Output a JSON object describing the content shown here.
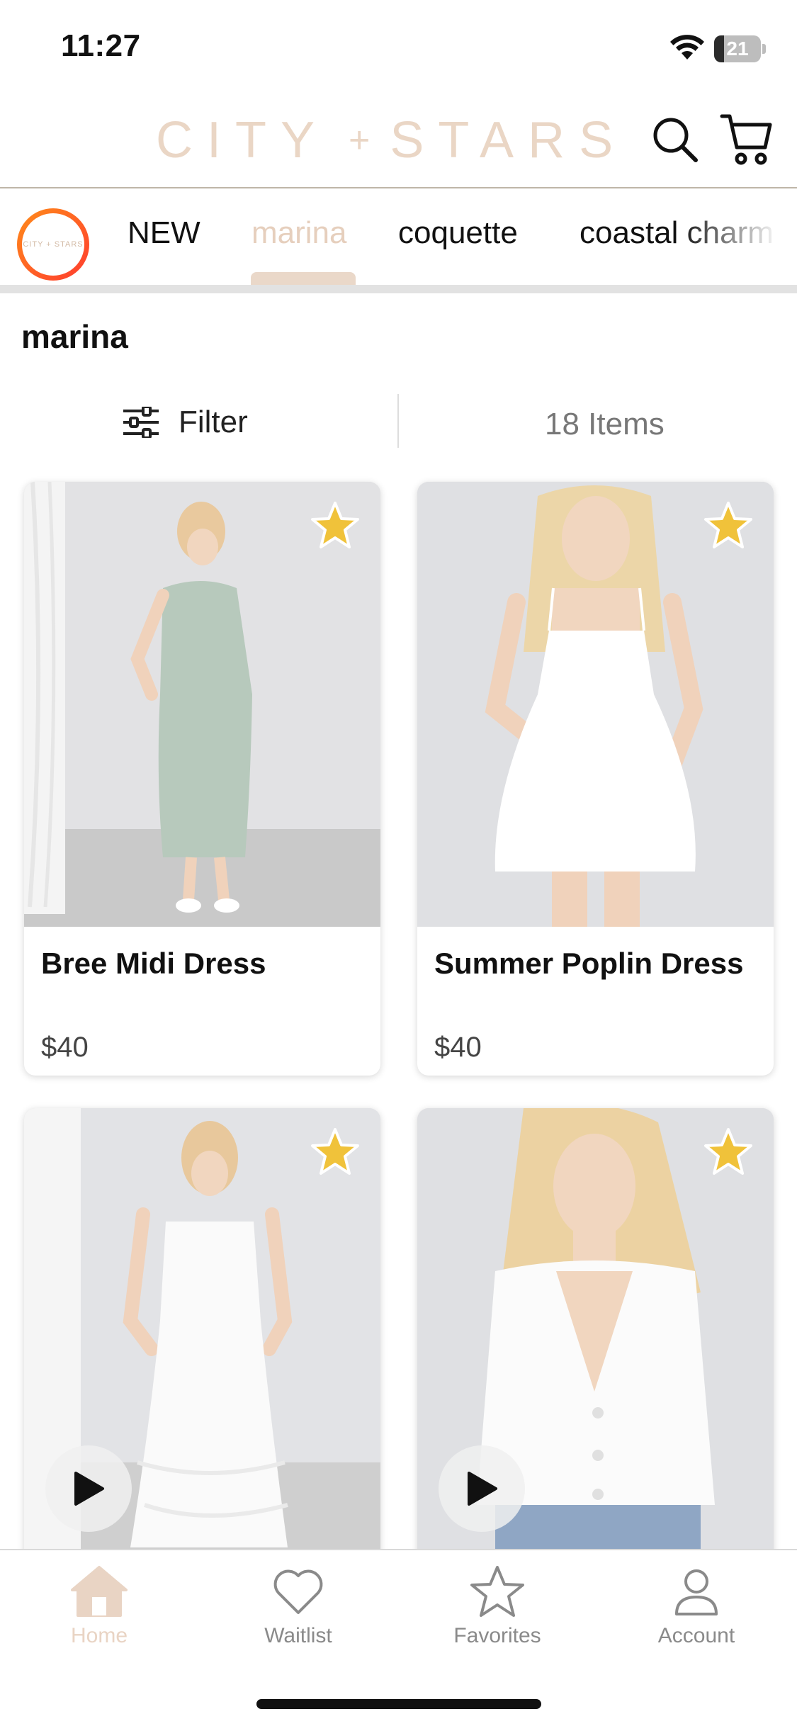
{
  "status_bar": {
    "time": "11:27",
    "battery_level": "21",
    "battery_fraction": 0.21
  },
  "header": {
    "brand_left": "CITY",
    "brand_plus": "+",
    "brand_right": "STARS"
  },
  "category_nav": {
    "logo_text": "CITY + STARS",
    "tabs": [
      {
        "label": "NEW",
        "active": false
      },
      {
        "label": "marina",
        "active": true
      },
      {
        "label": "coquette",
        "active": false
      },
      {
        "label": "coastal charm",
        "active": false
      }
    ]
  },
  "page": {
    "title": "marina"
  },
  "filter_bar": {
    "filter_label": "Filter",
    "items_count": "18 Items"
  },
  "products": [
    {
      "name": "Bree Midi Dress",
      "price": "$40",
      "favorite": true,
      "video": false
    },
    {
      "name": "Summer Poplin Dress",
      "price": "$40",
      "favorite": true,
      "video": false
    },
    {
      "name": "",
      "price": "",
      "favorite": true,
      "video": true
    },
    {
      "name": "",
      "price": "",
      "favorite": true,
      "video": true
    }
  ],
  "tab_bar": {
    "tabs": [
      {
        "label": "Home",
        "icon": "home-icon",
        "active": true
      },
      {
        "label": "Waitlist",
        "icon": "heart-icon",
        "active": false
      },
      {
        "label": "Favorites",
        "icon": "star-icon",
        "active": false
      },
      {
        "label": "Account",
        "icon": "person-icon",
        "active": false
      }
    ]
  },
  "colors": {
    "brand_accent": "#ead6c5",
    "favorite_star": "#f0c23a",
    "logo_gradient_start": "#ff8c1a",
    "logo_gradient_end": "#ff3b2f"
  }
}
